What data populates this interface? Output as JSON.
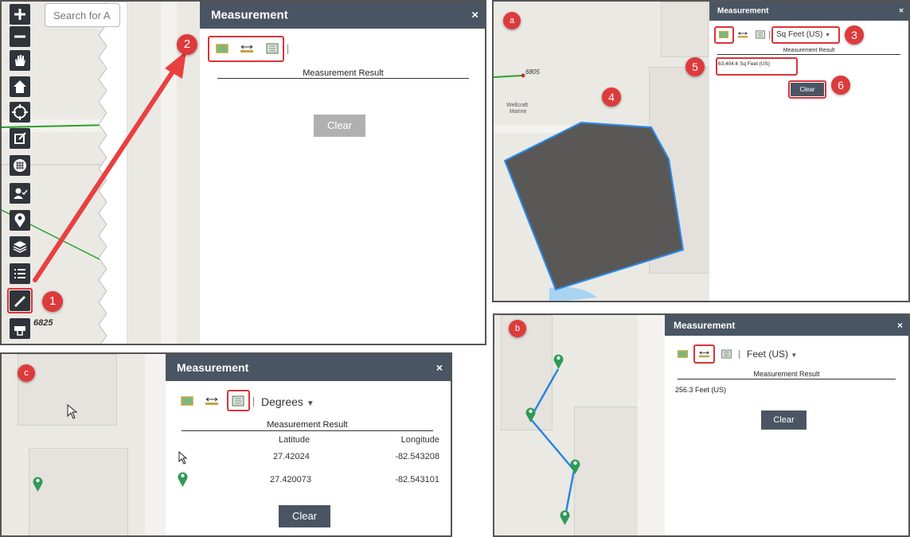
{
  "main_panel": {
    "search_placeholder": "Search for A",
    "map_label": "6825",
    "widget": {
      "title": "Measurement",
      "close": "×",
      "result_title": "Measurement Result",
      "clear_label": "Clear"
    },
    "callouts": [
      "1",
      "2"
    ],
    "toolbar_icons": [
      "zoom-in-icon",
      "zoom-out-icon",
      "pan-hand-icon",
      "home-icon",
      "locate-icon",
      "edit-icon",
      "basemap-icon",
      "user-check-icon",
      "view-pin-icon",
      "layers-icon",
      "legend-list-icon",
      "measure-ruler-icon",
      "print-icon"
    ]
  },
  "panel_a": {
    "label": "a",
    "map_label_number": "6805",
    "map_label_place": [
      "Wellcraft",
      "Marine"
    ],
    "widget": {
      "title": "Measurement",
      "close": "×",
      "unit": "Sq Feet (US)",
      "result_title": "Measurement Result",
      "result_value": "63,404.6 Sq Feet (US)",
      "clear_label": "Clear"
    },
    "callouts": [
      "3",
      "4",
      "5",
      "6"
    ],
    "colors": {
      "polygon_fill": "#595857",
      "polygon_stroke": "#2a8cf0"
    }
  },
  "panel_b": {
    "label": "b",
    "widget": {
      "title": "Measurement",
      "close": "×",
      "unit": "Feet (US)",
      "result_title": "Measurement Result",
      "result_value": "256.3 Feet (US)",
      "clear_label": "Clear"
    },
    "colors": {
      "line": "#2a86e0",
      "pin": "#2e9a55"
    }
  },
  "panel_c": {
    "label": "c",
    "widget": {
      "title": "Measurement",
      "close": "×",
      "unit": "Degrees",
      "result_title": "Measurement Result",
      "col_latitude": "Latitude",
      "col_longitude": "Longitude",
      "rows": [
        {
          "icon": "cursor-icon",
          "latitude": "27.42024",
          "longitude": "-82.543208"
        },
        {
          "icon": "green-pin-icon",
          "latitude": "27.420073",
          "longitude": "-82.543101"
        }
      ],
      "clear_label": "Clear"
    }
  },
  "colors": {
    "header": "#4a5563",
    "callout": "#dd3b3b",
    "highlight": "#d9333a",
    "arrow": "#e8403f"
  }
}
